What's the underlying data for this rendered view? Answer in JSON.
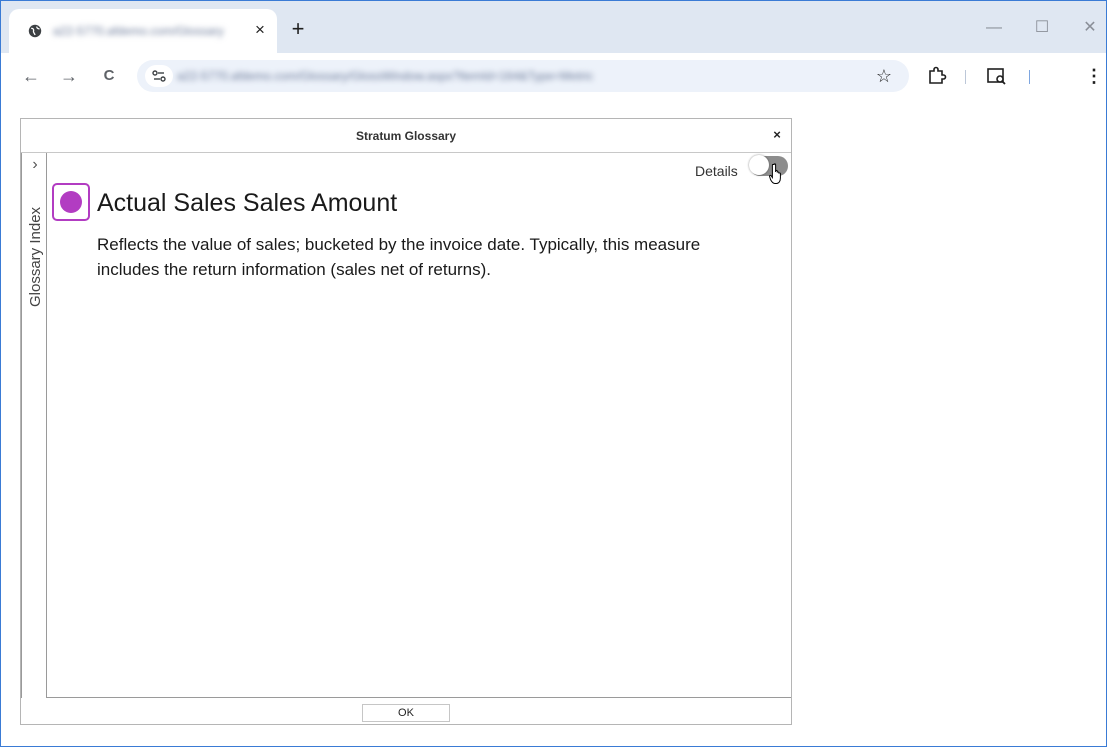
{
  "browser": {
    "tab": {
      "title": "a22-5770.afdemo.com/Glossary",
      "close_glyph": "×"
    },
    "new_tab_glyph": "+",
    "window_controls": {
      "minimize": "—",
      "maximize": "☐",
      "close": "✕"
    },
    "nav": {
      "back": "←",
      "forward": "→",
      "reload": "C"
    },
    "address": {
      "url": "a22-5770.afdemo.com/Glossary/GlossWindow.aspx?ItemId=164&Type=Metric"
    },
    "bookmark_glyph": "☆",
    "menu_glyph": "⋮"
  },
  "dialog": {
    "title": "Stratum Glossary",
    "close_glyph": "×",
    "index_label": "Glossary Index",
    "index_chevron": "›",
    "details_label": "Details",
    "details_on": false,
    "term": {
      "title": "Actual Sales Sales Amount",
      "description": "Reflects the value of sales; bucketed by the invoice date. Typically, this measure includes the return information (sales net of returns).",
      "icon_color": "#b23cc2"
    },
    "ok_label": "OK"
  },
  "colors": {
    "tabstrip": "#dfe7f2",
    "omnibox": "#edf2fa",
    "toggle_off": "#8d8d8d",
    "term_accent": "#b23cc2"
  },
  "icons": {
    "favicon": "globe-icon",
    "site_info": "tune-icon",
    "extensions": "puzzle-icon",
    "search_tab": "search-page-icon"
  }
}
